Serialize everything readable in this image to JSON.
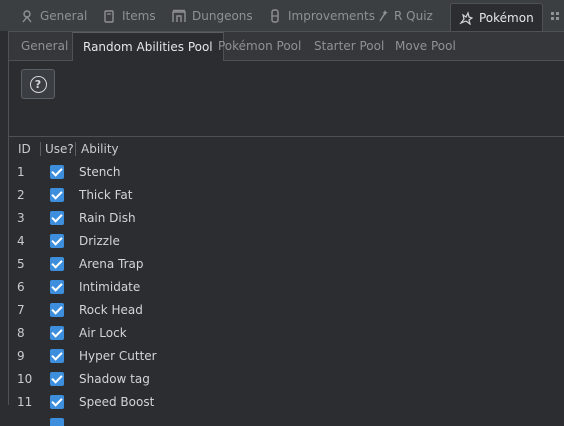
{
  "top_tabs": [
    {
      "label": "General",
      "icon": "general-icon"
    },
    {
      "label": "Items",
      "icon": "items-icon"
    },
    {
      "label": "Dungeons",
      "icon": "dungeons-icon"
    },
    {
      "label": "Improvements",
      "icon": "improvements-icon"
    },
    {
      "label": "R Quiz",
      "icon": "quiz-icon"
    },
    {
      "label": "Pokémon",
      "icon": "pokemon-icon",
      "active": true
    }
  ],
  "sub_tabs": [
    {
      "label": "General"
    },
    {
      "label": "Random Abilities Pool",
      "active": true
    },
    {
      "label": "Pokémon Pool"
    },
    {
      "label": "Starter Pool"
    },
    {
      "label": "Move Pool"
    }
  ],
  "toolbar": {
    "help_icon": "question-circle-icon",
    "help_glyph": "?"
  },
  "table": {
    "headers": {
      "id": "ID",
      "use": "Use?",
      "ability": "Ability"
    },
    "rows": [
      {
        "id": "1",
        "use": true,
        "ability": "Stench"
      },
      {
        "id": "2",
        "use": true,
        "ability": "Thick Fat"
      },
      {
        "id": "3",
        "use": true,
        "ability": "Rain Dish"
      },
      {
        "id": "4",
        "use": true,
        "ability": "Drizzle"
      },
      {
        "id": "5",
        "use": true,
        "ability": "Arena Trap"
      },
      {
        "id": "6",
        "use": true,
        "ability": "Intimidate"
      },
      {
        "id": "7",
        "use": true,
        "ability": "Rock Head"
      },
      {
        "id": "8",
        "use": true,
        "ability": "Air Lock"
      },
      {
        "id": "9",
        "use": true,
        "ability": "Hyper Cutter"
      },
      {
        "id": "10",
        "use": true,
        "ability": "Shadow tag"
      },
      {
        "id": "11",
        "use": true,
        "ability": "Speed Boost"
      }
    ]
  },
  "colors": {
    "accent": "#3d8fde",
    "background": "#2b2d30"
  }
}
